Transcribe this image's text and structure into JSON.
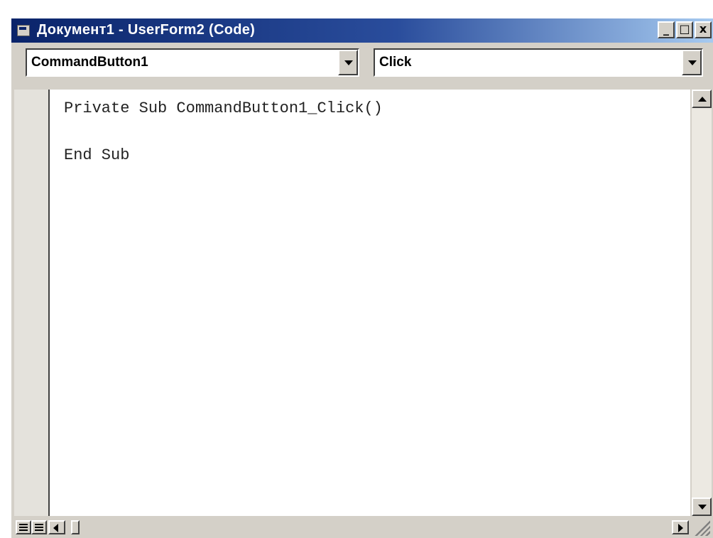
{
  "window": {
    "title": "Документ1 - UserForm2 (Code)",
    "controls": {
      "minimize_label": "_",
      "maximize_label": "□",
      "close_label": "x"
    }
  },
  "object_combo": {
    "value": "CommandButton1"
  },
  "procedure_combo": {
    "value": "Click"
  },
  "code_lines": [
    "Private Sub CommandButton1_Click()",
    "",
    "End Sub"
  ],
  "colors": {
    "titlebar_start": "#0a246a",
    "titlebar_end": "#a6caf0",
    "chrome": "#d4d0c8",
    "editor_bg": "#ffffff"
  }
}
